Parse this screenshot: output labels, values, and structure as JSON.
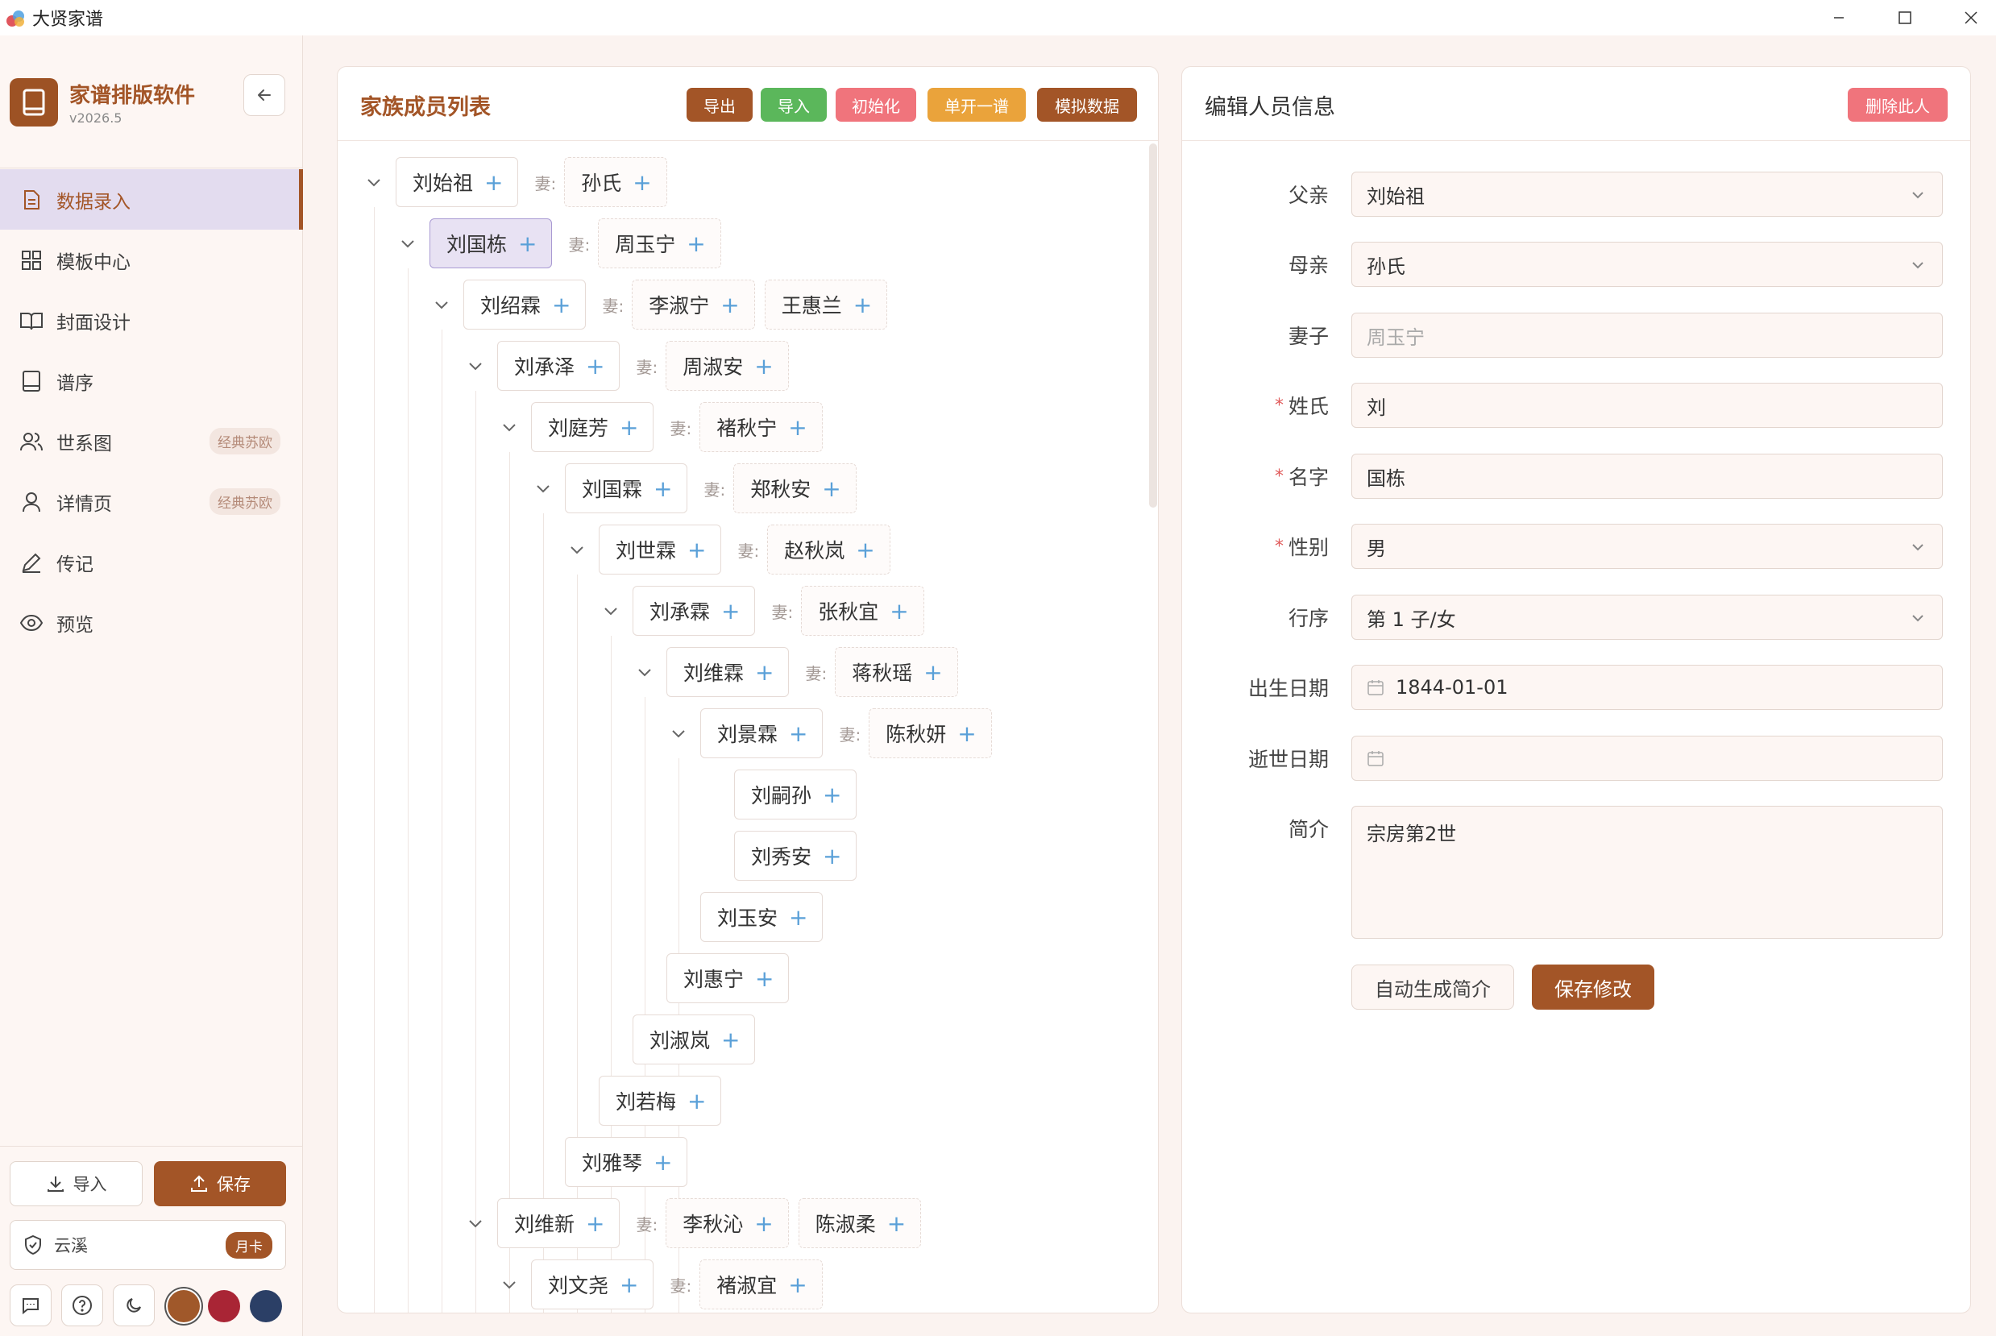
{
  "window": {
    "title": "大贤家谱"
  },
  "brand": {
    "name": "家谱排版软件",
    "version": "v2026.5"
  },
  "nav": [
    {
      "label": "数据录入",
      "icon": "document-icon",
      "active": true
    },
    {
      "label": "模板中心",
      "icon": "grid-icon"
    },
    {
      "label": "封面设计",
      "icon": "book-open-icon"
    },
    {
      "label": "谱序",
      "icon": "book-icon"
    },
    {
      "label": "世系图",
      "icon": "users-icon",
      "badge": "经典苏欧"
    },
    {
      "label": "详情页",
      "icon": "user-icon",
      "badge": "经典苏欧"
    },
    {
      "label": "传记",
      "icon": "pen-icon"
    },
    {
      "label": "预览",
      "icon": "eye-icon"
    }
  ],
  "sidebar_footer": {
    "import_label": "导入",
    "save_label": "保存",
    "cloud_label": "云溪",
    "cloud_badge": "月卡"
  },
  "theme_colors": [
    "#a0582a",
    "#a92535",
    "#2b3f66"
  ],
  "members_panel": {
    "title": "家族成员列表",
    "buttons": [
      {
        "label": "导出",
        "color": "#a35527"
      },
      {
        "label": "导入",
        "color": "#5bb75b"
      },
      {
        "label": "初始化",
        "color": "#f0747c"
      },
      {
        "label": "单开一谱",
        "color": "#eaa33b"
      },
      {
        "label": "模拟数据",
        "color": "#a35527"
      }
    ],
    "wife_label": "妻:",
    "tree": [
      {
        "name": "刘始祖",
        "level": 0,
        "expanded": true,
        "spouses": [
          "孙氏"
        ]
      },
      {
        "name": "刘国栋",
        "level": 1,
        "expanded": true,
        "selected": true,
        "spouses": [
          "周玉宁"
        ]
      },
      {
        "name": "刘绍霖",
        "level": 2,
        "expanded": true,
        "spouses": [
          "李淑宁",
          "王惠兰"
        ]
      },
      {
        "name": "刘承泽",
        "level": 3,
        "expanded": true,
        "spouses": [
          "周淑安"
        ]
      },
      {
        "name": "刘庭芳",
        "level": 4,
        "expanded": true,
        "spouses": [
          "褚秋宁"
        ]
      },
      {
        "name": "刘国霖",
        "level": 5,
        "expanded": true,
        "spouses": [
          "郑秋安"
        ]
      },
      {
        "name": "刘世霖",
        "level": 6,
        "expanded": true,
        "spouses": [
          "赵秋岚"
        ]
      },
      {
        "name": "刘承霖",
        "level": 7,
        "expanded": true,
        "spouses": [
          "张秋宜"
        ]
      },
      {
        "name": "刘维霖",
        "level": 8,
        "expanded": true,
        "spouses": [
          "蒋秋瑶"
        ]
      },
      {
        "name": "刘景霖",
        "level": 9,
        "expanded": true,
        "spouses": [
          "陈秋妍"
        ]
      },
      {
        "name": "刘嗣孙",
        "level": 10,
        "expanded": false,
        "spouses": []
      },
      {
        "name": "刘秀安",
        "level": 10,
        "leaf_offset": -1,
        "spouses": []
      },
      {
        "name": "刘玉安",
        "level": 9,
        "leaf_offset": -1,
        "spouses": []
      },
      {
        "name": "刘惠宁",
        "level": 8,
        "leaf_offset": -1,
        "spouses": []
      },
      {
        "name": "刘淑岚",
        "level": 7,
        "leaf_offset": -1,
        "spouses": []
      },
      {
        "name": "刘若梅",
        "level": 6,
        "leaf_offset": -1,
        "spouses": []
      },
      {
        "name": "刘雅琴",
        "level": 5,
        "leaf_offset": -1,
        "spouses": []
      },
      {
        "name": "刘维新",
        "level": 3,
        "expanded": true,
        "spouses": [
          "李秋沁",
          "陈淑柔"
        ]
      },
      {
        "name": "刘文尧",
        "level": 4,
        "expanded": true,
        "spouses": [
          "褚淑宜"
        ]
      }
    ]
  },
  "edit_panel": {
    "title": "编辑人员信息",
    "delete_label": "删除此人",
    "fields": {
      "father": {
        "label": "父亲",
        "value": "刘始祖"
      },
      "mother": {
        "label": "母亲",
        "value": "孙氏"
      },
      "wife": {
        "label": "妻子",
        "placeholder": "周玉宁"
      },
      "surname": {
        "label": "姓氏",
        "value": "刘",
        "required": true
      },
      "given_name": {
        "label": "名字",
        "value": "国栋",
        "required": true
      },
      "gender": {
        "label": "性别",
        "value": "男",
        "required": true
      },
      "rank": {
        "label": "行序",
        "value": "第 1 子/女"
      },
      "birth": {
        "label": "出生日期",
        "value": "1844-01-01"
      },
      "death": {
        "label": "逝世日期",
        "value": ""
      },
      "bio": {
        "label": "简介",
        "value": "宗房第2世"
      }
    },
    "auto_bio_label": "自动生成简介",
    "save_label": "保存修改"
  }
}
